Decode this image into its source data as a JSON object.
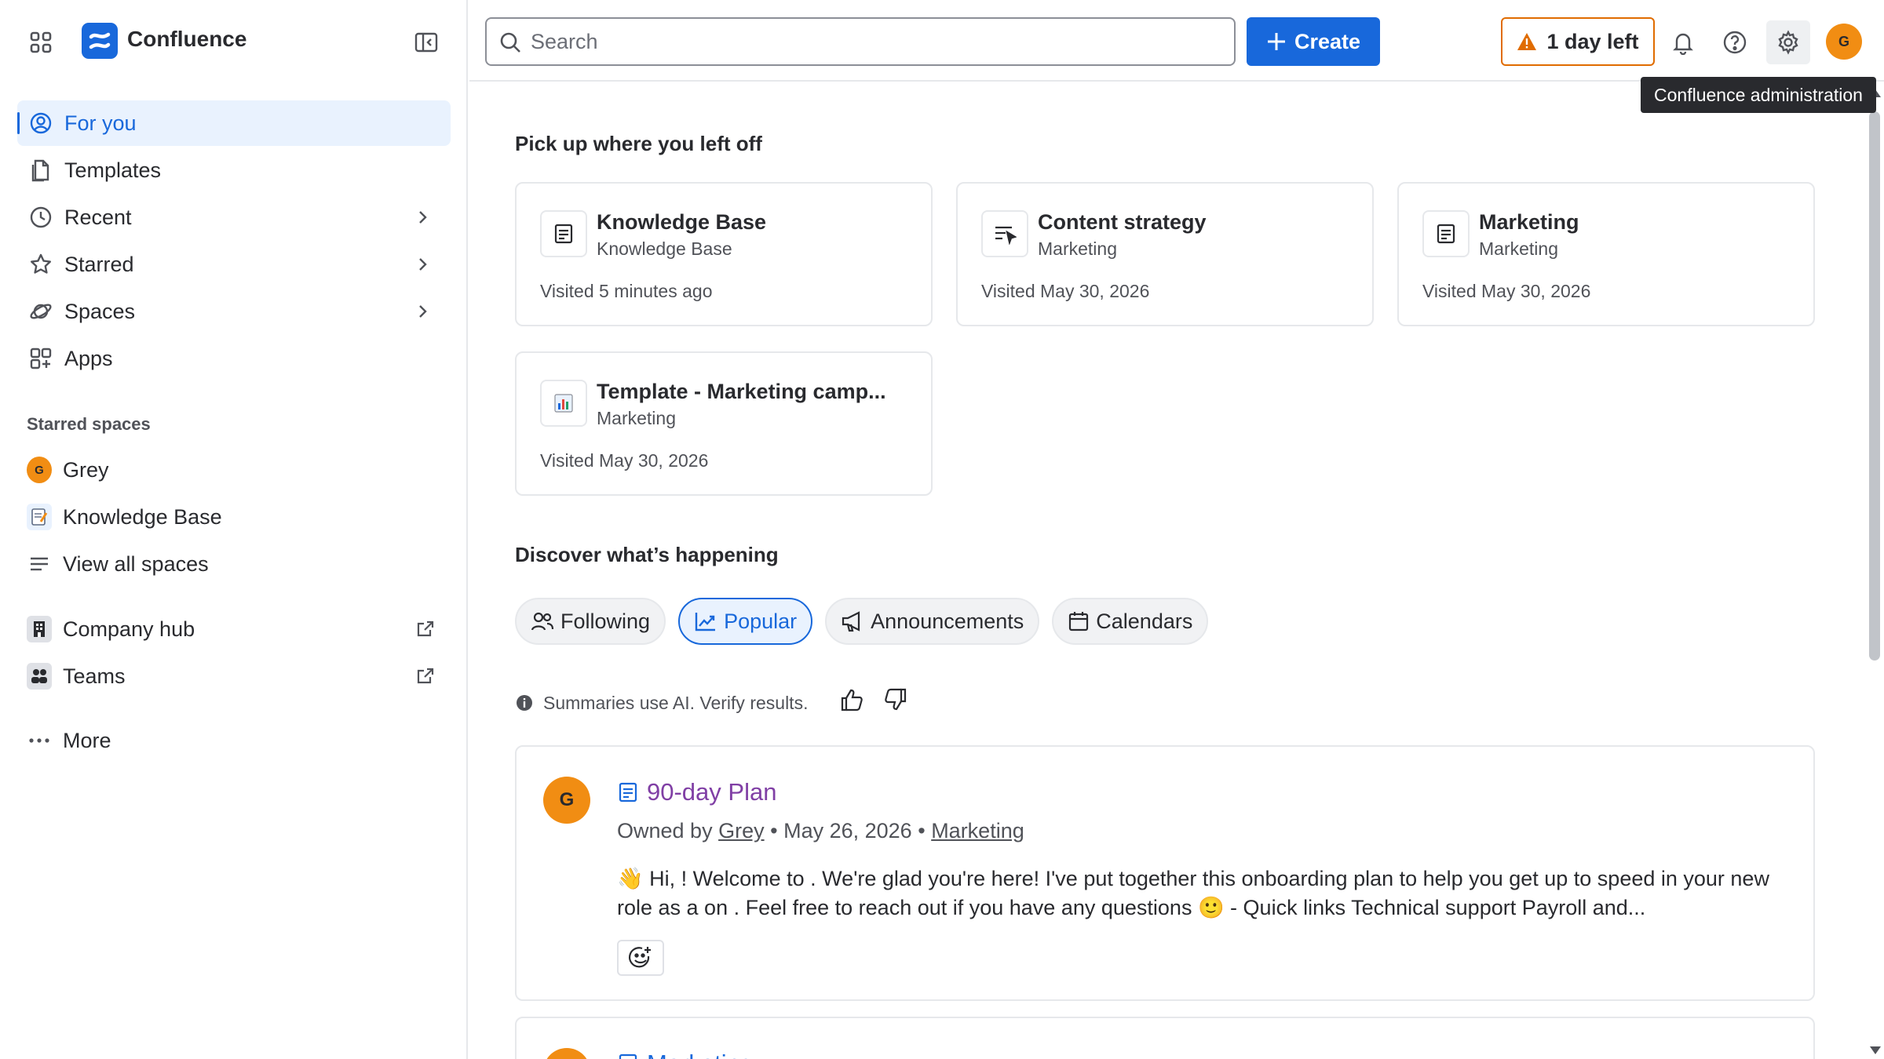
{
  "app": {
    "brand": "Confluence"
  },
  "sidebar": {
    "nav": [
      {
        "label": "For you",
        "icon": "user-circle-icon",
        "active": true
      },
      {
        "label": "Templates",
        "icon": "template-icon"
      },
      {
        "label": "Recent",
        "icon": "clock-icon",
        "expandable": true
      },
      {
        "label": "Starred",
        "icon": "star-icon",
        "expandable": true
      },
      {
        "label": "Spaces",
        "icon": "planet-icon",
        "expandable": true
      },
      {
        "label": "Apps",
        "icon": "apps-add-icon"
      }
    ],
    "starred_label": "Starred spaces",
    "starred_spaces": [
      {
        "label": "Grey",
        "avatar": "G"
      },
      {
        "label": "Knowledge Base",
        "icon": "notepad-emoji-icon"
      }
    ],
    "view_all": "View all spaces",
    "links": [
      {
        "label": "Company hub",
        "icon": "building-icon"
      },
      {
        "label": "Teams",
        "icon": "teams-icon"
      }
    ],
    "more": "More"
  },
  "topbar": {
    "search_placeholder": "Search",
    "create_label": "Create",
    "trial_label": "1 day left",
    "avatar": "G",
    "tooltip": "Confluence administration"
  },
  "main": {
    "recent_heading": "Pick up where you left off",
    "recent": [
      {
        "title": "Knowledge Base",
        "space": "Knowledge Base",
        "visited": "Visited 5 minutes ago",
        "icon": "page-icon"
      },
      {
        "title": "Content strategy",
        "space": "Marketing",
        "visited": "Visited May 30, 2026",
        "icon": "whiteboard-icon"
      },
      {
        "title": "Marketing",
        "space": "Marketing",
        "visited": "Visited May 30, 2026",
        "icon": "page-icon"
      },
      {
        "title": "Template - Marketing camp...",
        "space": "Marketing",
        "visited": "Visited May 30, 2026",
        "icon": "chart-emoji-icon"
      }
    ],
    "discover_heading": "Discover what’s happening",
    "tabs": [
      {
        "label": "Following",
        "icon": "people-icon"
      },
      {
        "label": "Popular",
        "icon": "trend-up-icon",
        "active": true
      },
      {
        "label": "Announcements",
        "icon": "megaphone-icon"
      },
      {
        "label": "Calendars",
        "icon": "calendar-icon"
      }
    ],
    "ai_note": "Summaries use AI. Verify results.",
    "feed": [
      {
        "avatar": "G",
        "title": "90-day Plan",
        "meta_prefix": "Owned by",
        "owner": "Grey",
        "date": "May 26, 2026",
        "space": "Marketing",
        "body": "👋 Hi, ! Welcome to . We're glad you're here! I've put together this onboarding plan to help you get up to speed in your new role as a on . Feel free to reach out if you have any questions 🙂 - Quick links Technical support Payroll and..."
      },
      {
        "avatar": "",
        "title": "Marketing"
      }
    ]
  },
  "colors": {
    "accent": "#1868db",
    "warning": "#e06c00",
    "avatar": "#f18d13",
    "link_visited": "#803fa5"
  }
}
